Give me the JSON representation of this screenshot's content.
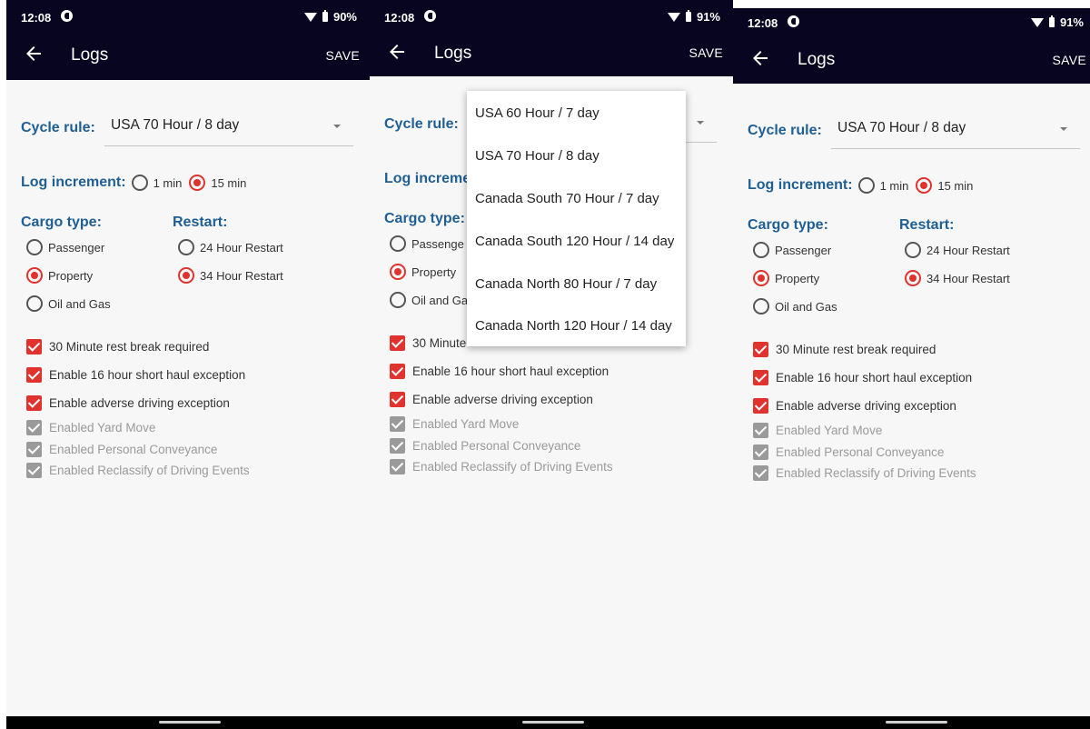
{
  "screens": [
    {
      "status": {
        "time": "12:08",
        "battery": "90%"
      },
      "appbar": {
        "title": "Logs",
        "save_label": "SAVE"
      },
      "cycle": {
        "label": "Cycle rule:",
        "value": "USA 70 Hour / 8 day"
      },
      "increment": {
        "label": "Log increment:",
        "options": [
          "1 min",
          "15 min"
        ],
        "selected": "15 min"
      },
      "cargo": {
        "label": "Cargo type:",
        "options": [
          "Passenger",
          "Property",
          "Oil and Gas"
        ],
        "selected": "Property"
      },
      "restart": {
        "label": "Restart:",
        "options": [
          "24 Hour Restart",
          "34 Hour Restart"
        ],
        "selected": "34 Hour Restart"
      },
      "checks": [
        {
          "label": "30 Minute rest break required",
          "checked": true,
          "enabled": true
        },
        {
          "label": "Enable 16 hour short haul exception",
          "checked": true,
          "enabled": true
        },
        {
          "label": "Enable adverse driving exception",
          "checked": true,
          "enabled": true
        },
        {
          "label": "Enabled Yard Move",
          "checked": true,
          "enabled": false
        },
        {
          "label": "Enabled Personal Conveyance",
          "checked": true,
          "enabled": false
        },
        {
          "label": "Enabled Reclassify of Driving Events",
          "checked": true,
          "enabled": false
        }
      ]
    },
    {
      "status": {
        "time": "12:08",
        "battery": "91%"
      },
      "appbar": {
        "title": "Logs",
        "save_label": "SAVE"
      },
      "cycle": {
        "label": "Cycle rule:",
        "value": ""
      },
      "increment": {
        "label": "Log increme",
        "options": [],
        "selected": ""
      },
      "cargo": {
        "label": "Cargo type:",
        "options": [
          "Passenge",
          "Property",
          "Oil and Ga"
        ],
        "selected": "Property"
      },
      "restart": {
        "label": "",
        "options": [],
        "selected": ""
      },
      "checks": [
        {
          "label": "30 Minute",
          "checked": true,
          "enabled": true
        },
        {
          "label": "Enable 16 hour short haul exception",
          "checked": true,
          "enabled": true
        },
        {
          "label": "Enable adverse driving exception",
          "checked": true,
          "enabled": true
        },
        {
          "label": "Enabled Yard Move",
          "checked": true,
          "enabled": false
        },
        {
          "label": "Enabled Personal Conveyance",
          "checked": true,
          "enabled": false
        },
        {
          "label": "Enabled Reclassify of Driving Events",
          "checked": true,
          "enabled": false
        }
      ],
      "dropdown": {
        "items": [
          "USA 60 Hour / 7 day",
          "USA 70 Hour / 8 day",
          "Canada South 70 Hour / 7 day",
          "Canada South 120 Hour / 14 day",
          "Canada North 80 Hour / 7 day",
          "Canada North 120 Hour / 14 day"
        ]
      }
    },
    {
      "status": {
        "time": "12:08",
        "battery": "91%"
      },
      "appbar": {
        "title": "Logs",
        "save_label": "SAVE"
      },
      "cycle": {
        "label": "Cycle rule:",
        "value": "USA 70 Hour / 8 day"
      },
      "increment": {
        "label": "Log increment:",
        "options": [
          "1 min",
          "15 min"
        ],
        "selected": "15 min"
      },
      "cargo": {
        "label": "Cargo type:",
        "options": [
          "Passenger",
          "Property",
          "Oil and Gas"
        ],
        "selected": "Property"
      },
      "restart": {
        "label": "Restart:",
        "options": [
          "24 Hour Restart",
          "34 Hour Restart"
        ],
        "selected": "34 Hour Restart"
      },
      "checks": [
        {
          "label": "30 Minute rest break required",
          "checked": true,
          "enabled": true
        },
        {
          "label": "Enable 16 hour short haul exception",
          "checked": true,
          "enabled": true
        },
        {
          "label": "Enable adverse driving exception",
          "checked": true,
          "enabled": true
        },
        {
          "label": "Enabled Yard Move",
          "checked": true,
          "enabled": false
        },
        {
          "label": "Enabled Personal Conveyance",
          "checked": true,
          "enabled": false
        },
        {
          "label": "Enabled Reclassify of Driving Events",
          "checked": true,
          "enabled": false
        }
      ]
    }
  ]
}
